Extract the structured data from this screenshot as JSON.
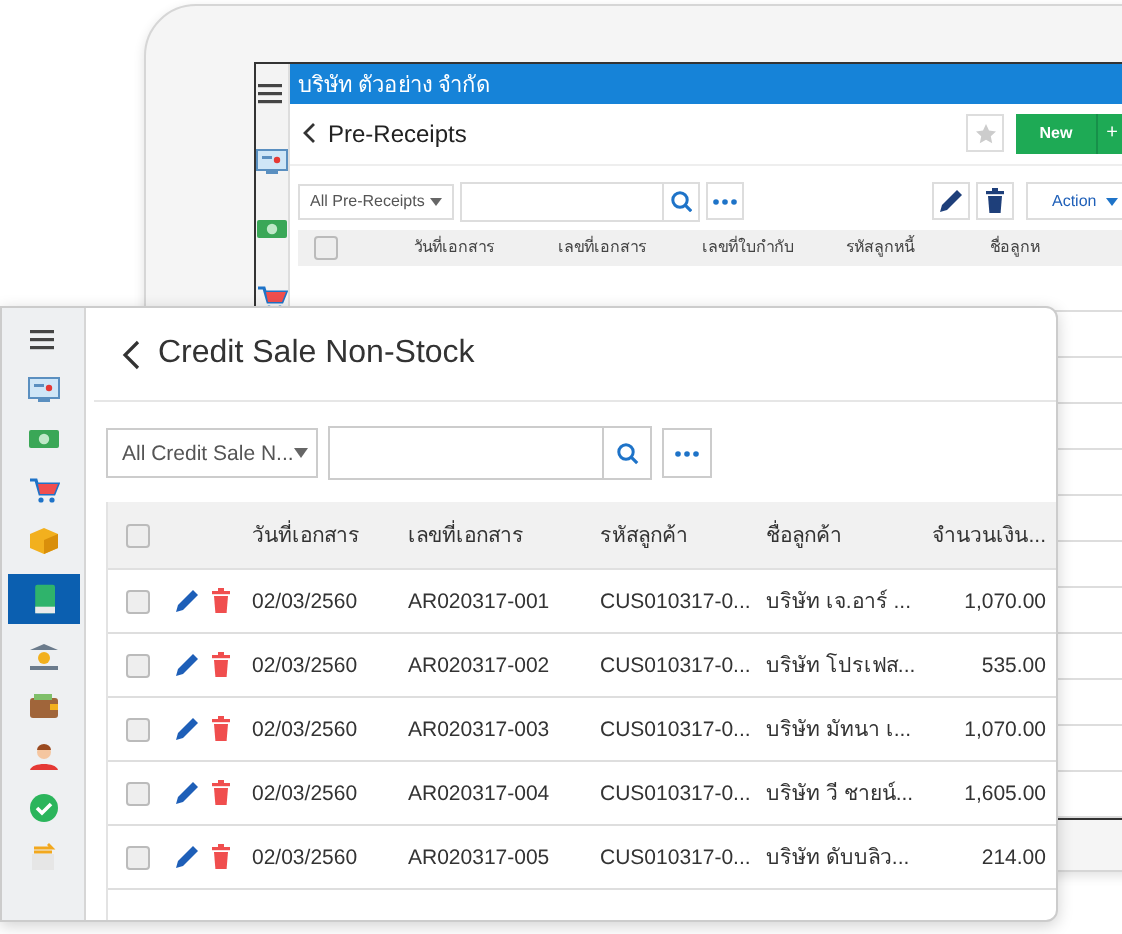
{
  "back_window": {
    "company": "บริษัท ตัวอย่าง จำกัด",
    "sidebar": [
      {
        "kind": "menu"
      },
      {
        "kind": "monitor"
      },
      {
        "kind": "money"
      },
      {
        "kind": "cart"
      }
    ],
    "title": "Pre-Receipts",
    "new_button": "New",
    "new_plus": "+",
    "filter": "All Pre-Receipts",
    "action_button": "Action",
    "select_all_checked": false,
    "columns": [
      "วันที่เอกสาร",
      "เลขที่เอกสาร",
      "เลขที่ใบกำกับ",
      "รหัสลูกหนี้",
      "ชื่อลูกห"
    ]
  },
  "front_window": {
    "title": "Credit Sale Non-Stock",
    "filter": "All Credit Sale N...",
    "select_all_checked": false,
    "sidebar": [
      {
        "kind": "menu",
        "selected": false
      },
      {
        "kind": "monitor",
        "selected": false
      },
      {
        "kind": "money",
        "selected": false
      },
      {
        "kind": "cart",
        "selected": false
      },
      {
        "kind": "box",
        "selected": false
      },
      {
        "kind": "book",
        "selected": true
      },
      {
        "kind": "bank",
        "selected": false
      },
      {
        "kind": "wallet",
        "selected": false
      },
      {
        "kind": "person",
        "selected": false
      },
      {
        "kind": "check",
        "selected": false
      },
      {
        "kind": "transfer",
        "selected": false
      }
    ],
    "columns": [
      "วันที่เอกสาร",
      "เลขที่เอกสาร",
      "รหัสลูกค้า",
      "ชื่อลูกค้า",
      "จำนวนเงิน..."
    ],
    "rows": [
      {
        "checked": false,
        "date": "02/03/2560",
        "doc_no": "AR020317-001",
        "customer_code": "CUS010317-0...",
        "customer_name": "บริษัท เจ.อาร์ ...",
        "amount": "1,070.00"
      },
      {
        "checked": false,
        "date": "02/03/2560",
        "doc_no": "AR020317-002",
        "customer_code": "CUS010317-0...",
        "customer_name": "บริษัท โปรเฟส...",
        "amount": "535.00"
      },
      {
        "checked": false,
        "date": "02/03/2560",
        "doc_no": "AR020317-003",
        "customer_code": "CUS010317-0...",
        "customer_name": "บริษัท มัทนา เ...",
        "amount": "1,070.00"
      },
      {
        "checked": false,
        "date": "02/03/2560",
        "doc_no": "AR020317-004",
        "customer_code": "CUS010317-0...",
        "customer_name": "บริษัท วี ชายน์...",
        "amount": "1,605.00"
      },
      {
        "checked": false,
        "date": "02/03/2560",
        "doc_no": "AR020317-005",
        "customer_code": "CUS010317-0...",
        "customer_name": "บริษัท ดับบลิว...",
        "amount": "214.00"
      }
    ]
  }
}
